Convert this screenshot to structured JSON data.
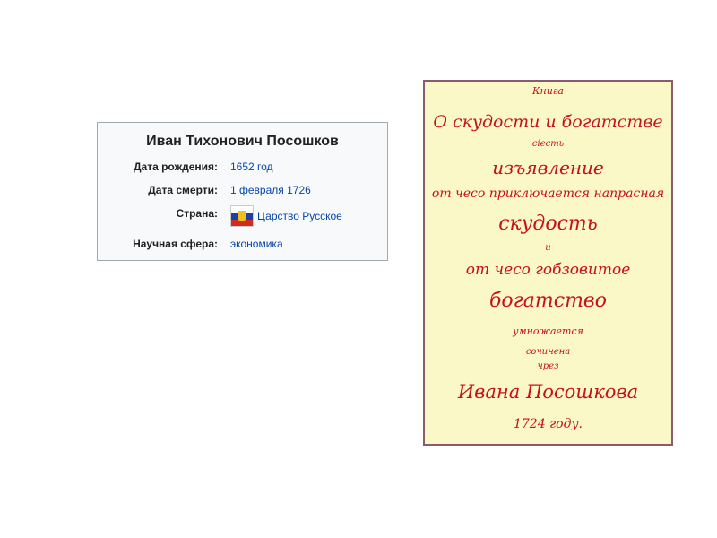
{
  "infobox": {
    "title": "Иван Тихонович Посошков",
    "rows": [
      {
        "label": "Дата рождения:",
        "value": "1652 год"
      },
      {
        "label": "Дата смерти:",
        "value": "1 февраля 1726"
      },
      {
        "label": "Страна:",
        "value": "Царство Русское",
        "flag_icon": "russian-tsardom-flag-icon"
      },
      {
        "label": "Научная сфера:",
        "value": "экономика"
      }
    ],
    "link_color": "#0645ad"
  },
  "manuscript": {
    "ink_color": "#c8101a",
    "paper_color": "#fbf8c8",
    "lines": [
      "Книга",
      "О скудости и богатстве",
      "сіесть",
      "изъявление",
      "от чесо приключается напрасная",
      "скудость",
      "и",
      "от чесо гобзовитое",
      "богатство",
      "умножается",
      "сочинена",
      "чрез",
      "Ивана Посошкова",
      "1724 году."
    ]
  }
}
